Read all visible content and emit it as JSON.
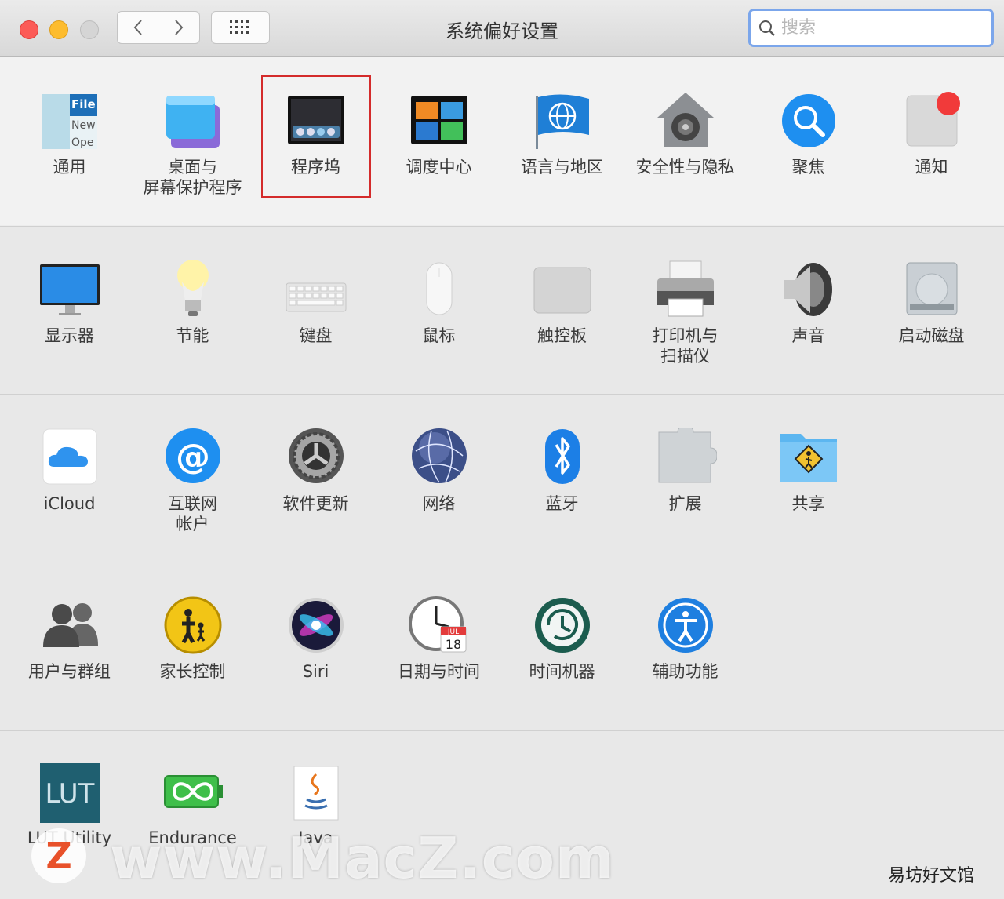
{
  "window": {
    "title": "系统偏好设置"
  },
  "search": {
    "placeholder": "搜索"
  },
  "rows": [
    [
      "通用",
      "桌面与\n屏幕保护程序",
      "程序坞",
      "调度中心",
      "语言与地区",
      "安全性与隐私",
      "聚焦",
      "通知"
    ],
    [
      "显示器",
      "节能",
      "键盘",
      "鼠标",
      "触控板",
      "打印机与\n扫描仪",
      "声音",
      "启动磁盘"
    ],
    [
      "iCloud",
      "互联网\n帐户",
      "软件更新",
      "网络",
      "蓝牙",
      "扩展",
      "共享"
    ],
    [
      "用户与群组",
      "家长控制",
      "Siri",
      "日期与时间",
      "时间机器",
      "辅助功能"
    ],
    [
      "LUT Utility",
      "Endurance",
      "Java"
    ]
  ],
  "icons": {
    "general": {
      "text1": "File",
      "text2": "New",
      "text3": "Ope"
    },
    "lut": {
      "text": "LUT"
    },
    "datetime": {
      "month": "JUL",
      "day": "18"
    }
  },
  "highlighted_item": "程序坞",
  "watermark": {
    "logo": "Z",
    "text": "www.MacZ.com",
    "corner": "易坊好文馆"
  }
}
